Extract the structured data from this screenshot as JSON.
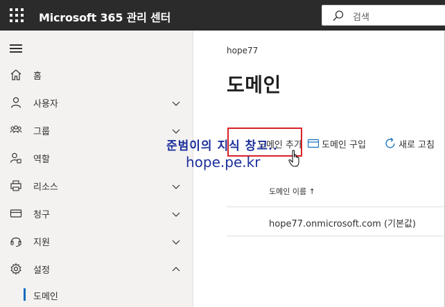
{
  "topbar": {
    "title": "Microsoft 365 관리 센터",
    "search_placeholder": "검색"
  },
  "sidebar": {
    "items": [
      {
        "label": "홈",
        "icon": "home-icon",
        "expandable": false
      },
      {
        "label": "사용자",
        "icon": "user-icon",
        "expandable": true
      },
      {
        "label": "그룹",
        "icon": "group-icon",
        "expandable": true
      },
      {
        "label": "역할",
        "icon": "role-icon",
        "expandable": false
      },
      {
        "label": "리소스",
        "icon": "printer-icon",
        "expandable": true
      },
      {
        "label": "청구",
        "icon": "card-icon",
        "expandable": true
      },
      {
        "label": "지원",
        "icon": "headset-icon",
        "expandable": true
      },
      {
        "label": "설정",
        "icon": "gear-icon",
        "expandable": true,
        "expanded": true
      }
    ],
    "sub_item": "도메인"
  },
  "main": {
    "breadcrumb": "hope77",
    "title": "도메인",
    "commands": {
      "add_domain": "도메인 추가",
      "buy_domain": "도메인 구입",
      "refresh": "새로 고침"
    },
    "table": {
      "column": "도메인 이름 ↑",
      "rows": [
        "hope77.onmicrosoft.com (기본값)"
      ]
    }
  },
  "watermark": {
    "line1": "준범이의 지식 창고..",
    "line2": "hope.pe.kr"
  },
  "colors": {
    "topbar": "#2b2b2b",
    "sidebar": "#f3f2f1",
    "accent": "#0f6cbd",
    "highlight": "#d81f26",
    "watermark": "#1c2f9b"
  }
}
